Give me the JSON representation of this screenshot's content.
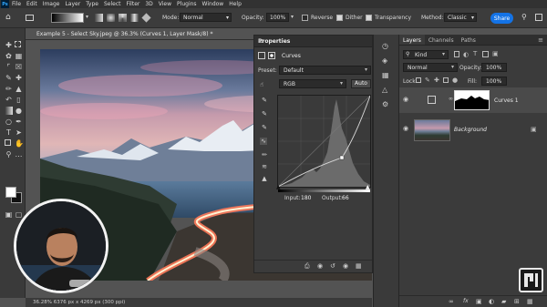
{
  "menubar": {
    "app_logo": "Ps",
    "items": [
      "File",
      "Edit",
      "Image",
      "Layer",
      "Type",
      "Select",
      "Filter",
      "3D",
      "View",
      "Plugins",
      "Window",
      "Help"
    ]
  },
  "options": {
    "mode_label": "Mode:",
    "mode_value": "Normal",
    "opacity_label": "Opacity:",
    "opacity_value": "100%",
    "reverse_label": "Reverse",
    "dither_label": "Dither",
    "transparency_label": "Transparency",
    "method_label": "Method:",
    "method_value": "Classic",
    "share_label": "Share"
  },
  "document": {
    "tab_title": "Example 5 - Select Sky.jpeg @ 36.3% (Curves 1, Layer Mask/8) *",
    "status": "36.28%    6376 px x 4269 px (300 ppi)"
  },
  "properties": {
    "title": "Properties",
    "panel_name": "Curves",
    "preset_label": "Preset:",
    "preset_value": "Default",
    "channel_value": "RGB",
    "auto_label": "Auto",
    "input_label": "Input:",
    "input_value": "180",
    "output_label": "Output:",
    "output_value": "66"
  },
  "layers": {
    "tabs": [
      "Layers",
      "Channels",
      "Paths"
    ],
    "kind_label": "Kind",
    "blend_value": "Normal",
    "opacity_label": "Opacity:",
    "opacity_value": "100%",
    "lock_label": "Lock:",
    "fill_label": "Fill:",
    "fill_value": "100%",
    "items": [
      {
        "name": "Curves 1"
      },
      {
        "name": "Background"
      }
    ]
  },
  "colors": {
    "accent": "#1473e6",
    "panel": "#3b3b3b",
    "background": "#535353"
  }
}
